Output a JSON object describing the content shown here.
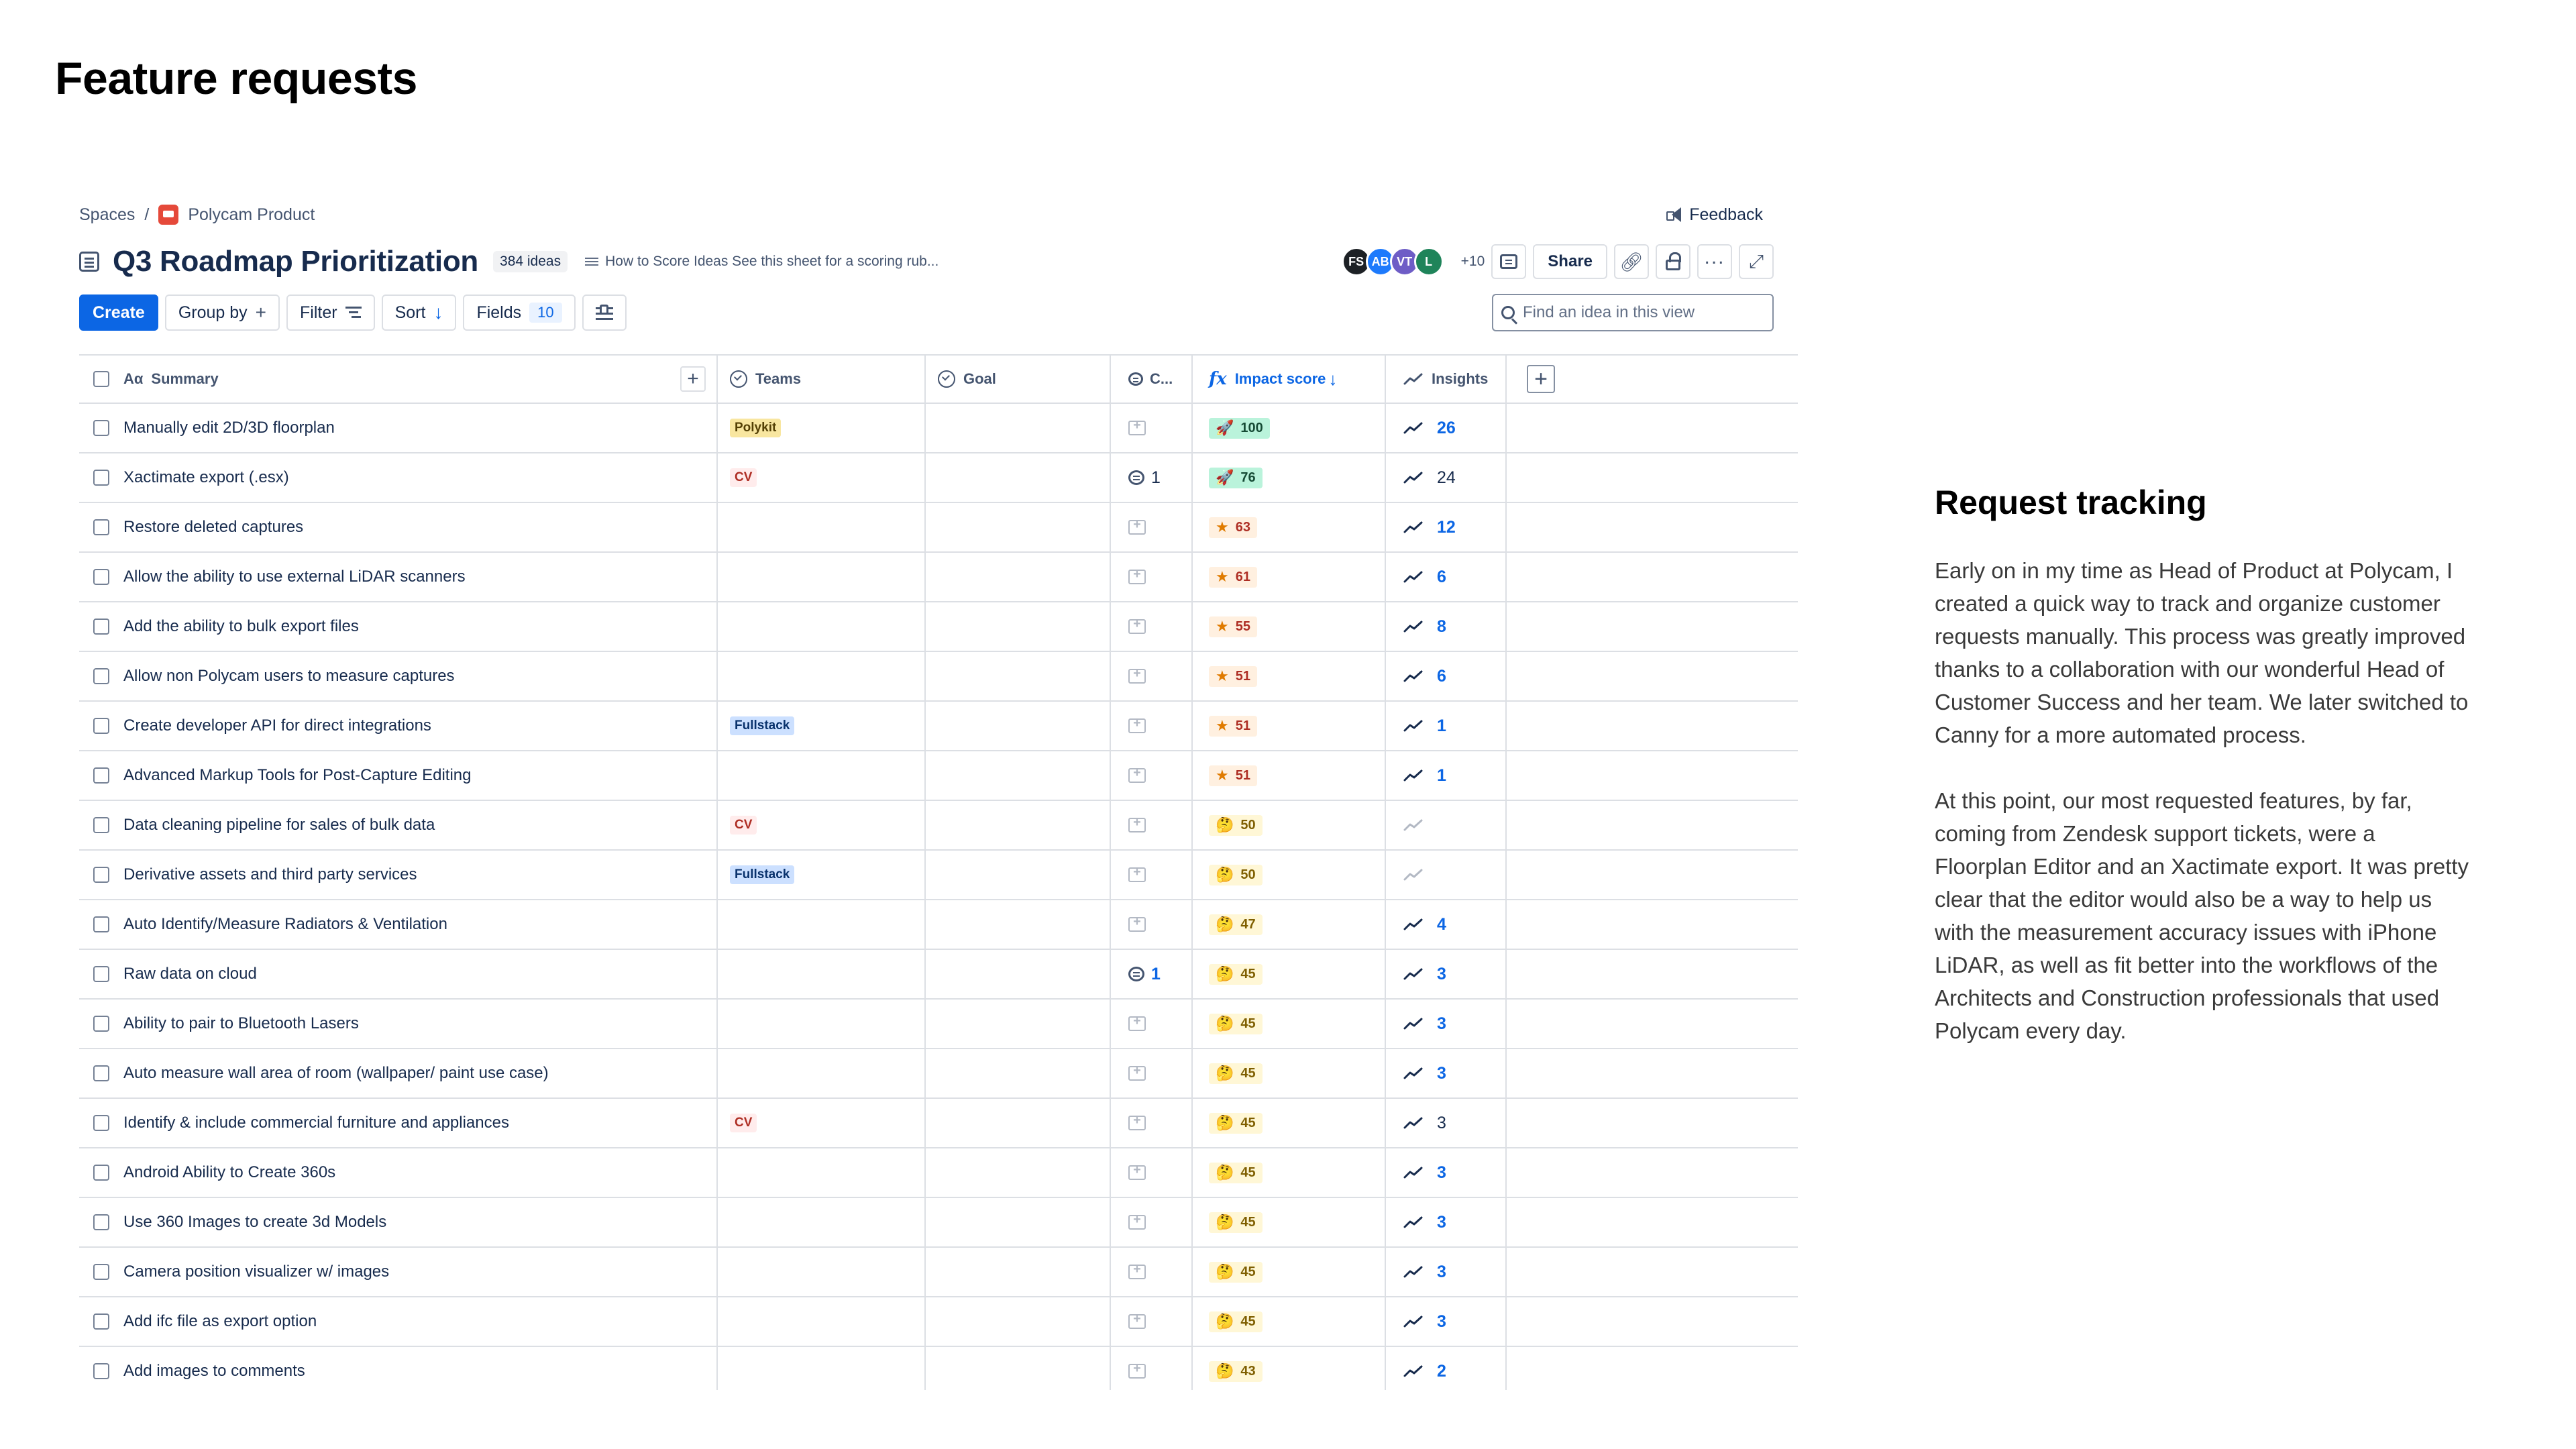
{
  "page": {
    "heading": "Feature requests"
  },
  "breadcrumb": {
    "root": "Spaces",
    "separator": "/",
    "space": "Polycam Product",
    "feedback": "Feedback"
  },
  "header": {
    "title": "Q3 Roadmap Prioritization",
    "count": "384 ideas",
    "description": "How to Score Ideas See this sheet for a scoring rub...",
    "avatars": [
      {
        "initials": "FS",
        "color": "#1d2125"
      },
      {
        "initials": "AB",
        "color": "#1d7afc"
      },
      {
        "initials": "VT",
        "color": "#6e5dc6"
      },
      {
        "initials": "L",
        "color": "#1f845a"
      }
    ],
    "more_avatars": "+10",
    "share": "Share"
  },
  "toolbar": {
    "create": "Create",
    "group_by": "Group by",
    "filter": "Filter",
    "sort": "Sort",
    "fields": "Fields",
    "fields_count": "10",
    "search_placeholder": "Find an idea in this view"
  },
  "columns": {
    "summary": "Summary",
    "teams": "Teams",
    "goal": "Goal",
    "comments": "C...",
    "impact": "Impact score",
    "insights": "Insights"
  },
  "rows": [
    {
      "summary": "Manually edit 2D/3D floorplan",
      "team": "Polykit",
      "team_class": "tag-polykit",
      "comments": "",
      "score": "100",
      "score_class": "score-high",
      "score_icon": "🚀",
      "insights": "26",
      "insights_style": "blue"
    },
    {
      "summary": "Xactimate export (.esx)",
      "team": "CV",
      "team_class": "tag-cv",
      "comments": "1",
      "comments_style": "dark",
      "score": "76",
      "score_class": "score-high",
      "score_icon": "🚀",
      "insights": "24",
      "insights_style": "dark"
    },
    {
      "summary": "Restore deleted captures",
      "team": "",
      "comments": "",
      "score": "63",
      "score_class": "score-mid",
      "score_icon": "★",
      "insights": "12",
      "insights_style": "blue"
    },
    {
      "summary": "Allow the ability to use external LiDAR scanners",
      "team": "",
      "comments": "",
      "score": "61",
      "score_class": "score-mid",
      "score_icon": "★",
      "insights": "6",
      "insights_style": "blue"
    },
    {
      "summary": "Add the ability to bulk export files",
      "team": "",
      "comments": "",
      "score": "55",
      "score_class": "score-mid",
      "score_icon": "★",
      "insights": "8",
      "insights_style": "blue"
    },
    {
      "summary": "Allow non Polycam users to measure captures",
      "team": "",
      "comments": "",
      "score": "51",
      "score_class": "score-mid",
      "score_icon": "★",
      "insights": "6",
      "insights_style": "blue"
    },
    {
      "summary": "Create developer API for direct integrations",
      "team": "Fullstack",
      "team_class": "tag-fullstack",
      "comments": "",
      "score": "51",
      "score_class": "score-mid",
      "score_icon": "★",
      "insights": "1",
      "insights_style": "blue"
    },
    {
      "summary": "Advanced Markup Tools for Post-Capture Editing",
      "team": "",
      "comments": "",
      "score": "51",
      "score_class": "score-mid",
      "score_icon": "★",
      "insights": "1",
      "insights_style": "blue"
    },
    {
      "summary": "Data cleaning pipeline for sales of bulk data",
      "team": "CV",
      "team_class": "tag-cv",
      "comments": "",
      "score": "50",
      "score_class": "score-low",
      "score_icon": "🤔",
      "insights": "",
      "insights_style": "none"
    },
    {
      "summary": "Derivative assets and third party services",
      "team": "Fullstack",
      "team_class": "tag-fullstack",
      "comments": "",
      "score": "50",
      "score_class": "score-low",
      "score_icon": "🤔",
      "insights": "",
      "insights_style": "none"
    },
    {
      "summary": "Auto Identify/Measure Radiators & Ventilation",
      "team": "",
      "comments": "",
      "score": "47",
      "score_class": "score-low",
      "score_icon": "🤔",
      "insights": "4",
      "insights_style": "blue"
    },
    {
      "summary": "Raw data on cloud",
      "team": "",
      "comments": "1",
      "comments_style": "blue",
      "score": "45",
      "score_class": "score-low",
      "score_icon": "🤔",
      "insights": "3",
      "insights_style": "blue"
    },
    {
      "summary": "Ability to pair to Bluetooth Lasers",
      "team": "",
      "comments": "",
      "score": "45",
      "score_class": "score-low",
      "score_icon": "🤔",
      "insights": "3",
      "insights_style": "blue"
    },
    {
      "summary": "Auto measure wall area of room (wallpaper/ paint use case)",
      "team": "",
      "comments": "",
      "score": "45",
      "score_class": "score-low",
      "score_icon": "🤔",
      "insights": "3",
      "insights_style": "blue"
    },
    {
      "summary": "Identify & include commercial furniture and appliances",
      "team": "CV",
      "team_class": "tag-cv",
      "comments": "",
      "score": "45",
      "score_class": "score-low",
      "score_icon": "🤔",
      "insights": "3",
      "insights_style": "dark"
    },
    {
      "summary": "Android Ability to Create 360s",
      "team": "",
      "comments": "",
      "score": "45",
      "score_class": "score-low",
      "score_icon": "🤔",
      "insights": "3",
      "insights_style": "blue"
    },
    {
      "summary": "Use 360 Images to create 3d Models",
      "team": "",
      "comments": "",
      "score": "45",
      "score_class": "score-low",
      "score_icon": "🤔",
      "insights": "3",
      "insights_style": "blue"
    },
    {
      "summary": "Camera position visualizer w/ images",
      "team": "",
      "comments": "",
      "score": "45",
      "score_class": "score-low",
      "score_icon": "🤔",
      "insights": "3",
      "insights_style": "blue"
    },
    {
      "summary": "Add ifc file as export option",
      "team": "",
      "comments": "",
      "score": "45",
      "score_class": "score-low",
      "score_icon": "🤔",
      "insights": "3",
      "insights_style": "blue"
    },
    {
      "summary": "Add images to comments",
      "team": "",
      "comments": "",
      "score": "43",
      "score_class": "score-low",
      "score_icon": "🤔",
      "insights": "2",
      "insights_style": "blue"
    }
  ],
  "side": {
    "heading": "Request tracking",
    "paragraph_1": "Early on in my time as Head of Product at Polycam, I created a quick way to track and organize customer requests manually. This process was greatly improved thanks to a collaboration with our wonderful Head of Customer Success and her team. We later switched to Canny for a more automated process.",
    "paragraph_2": "At this point, our most requested features, by far, coming from Zendesk support tickets, were a Floorplan Editor and an Xactimate export. It was pretty clear that the editor would also be a way to help us with the measurement accuracy issues with iPhone LiDAR, as well as fit better into the workflows of the Architects and Construction professionals that used Polycam every day."
  },
  "icons": {
    "space": "polycam-logo-icon",
    "feedback": "megaphone-icon",
    "view": "list-icon",
    "description": "text-lines-icon",
    "comment": "comment-icon",
    "link": "link-icon",
    "lock": "unlock-icon",
    "more": "more-icon",
    "expand": "expand-icon",
    "search": "search-icon",
    "trend": "trend-up-icon"
  },
  "colors": {
    "primary": "#0c66e4",
    "border": "#dcdfe4"
  }
}
